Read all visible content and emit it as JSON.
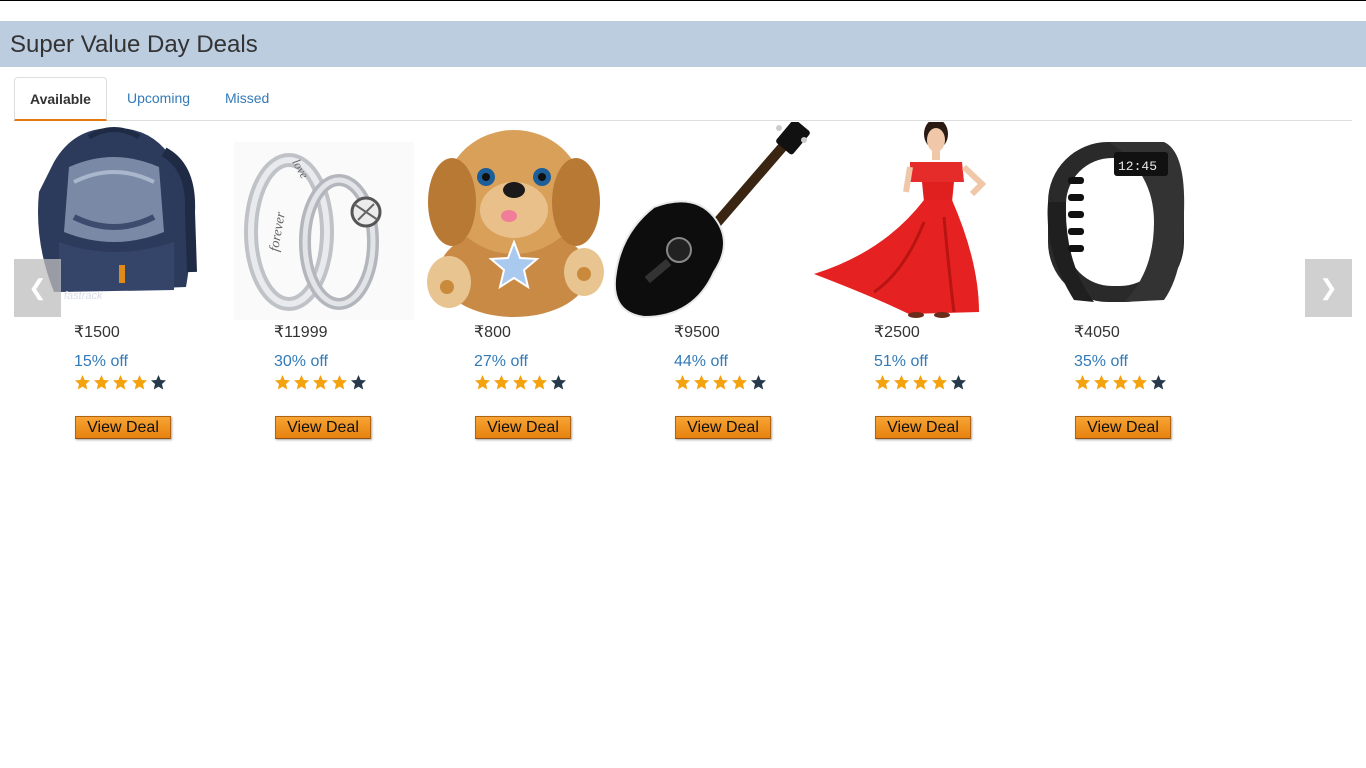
{
  "page_title": "Super Value Day Deals",
  "tabs": [
    {
      "label": "Available",
      "active": true
    },
    {
      "label": "Upcoming",
      "active": false
    },
    {
      "label": "Missed",
      "active": false
    }
  ],
  "carousel": {
    "prev_glyph": "❮",
    "next_glyph": "❯"
  },
  "deals": [
    {
      "product": "backpack",
      "price": "₹1500",
      "discount": "15% off",
      "rating": 4,
      "max_rating": 5,
      "button": "View Deal"
    },
    {
      "product": "couple-rings",
      "price": "₹11999",
      "discount": "30% off",
      "rating": 4,
      "max_rating": 5,
      "button": "View Deal"
    },
    {
      "product": "plush-puppy",
      "price": "₹800",
      "discount": "27% off",
      "rating": 4,
      "max_rating": 5,
      "button": "View Deal"
    },
    {
      "product": "acoustic-guitar",
      "price": "₹9500",
      "discount": "44% off",
      "rating": 4,
      "max_rating": 5,
      "button": "View Deal"
    },
    {
      "product": "red-gown",
      "price": "₹2500",
      "discount": "51% off",
      "rating": 4,
      "max_rating": 5,
      "button": "View Deal"
    },
    {
      "product": "fitness-tracker",
      "price": "₹4050",
      "discount": "35% off",
      "rating": 4,
      "max_rating": 5,
      "button": "View Deal"
    }
  ],
  "ring_engravings": {
    "left": "forever",
    "right": "love"
  },
  "watch_display": "12:45",
  "colors": {
    "header_bg": "#bccde0",
    "link": "#337ab7",
    "active_tab_underline": "#e47911",
    "star_filled": "#f5a20f",
    "star_empty": "#263a4c",
    "button": "#f0951c"
  }
}
